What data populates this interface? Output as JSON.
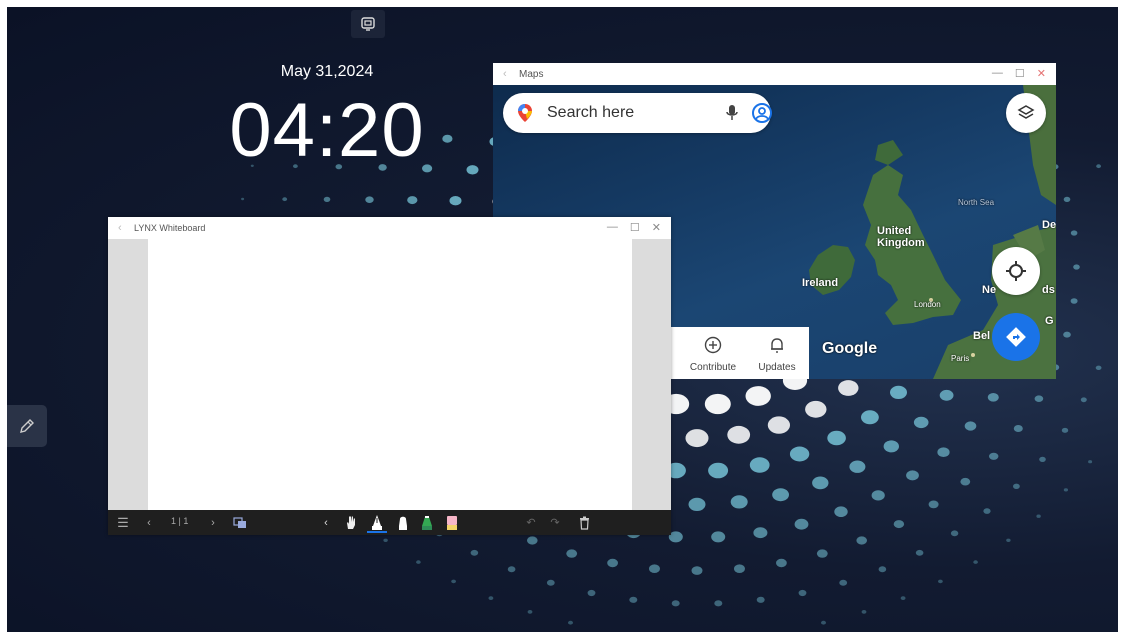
{
  "desktop": {
    "date": "May 31,2024",
    "time": "04:20",
    "top_icon": "screen-share-icon",
    "side_icon": "pencil-icon"
  },
  "maps_window": {
    "title": "Maps",
    "search": {
      "placeholder": "Search here"
    },
    "icons": [
      "maps-pin-icon",
      "microphone-icon",
      "account-icon",
      "layers-icon",
      "my-location-icon",
      "directions-icon"
    ],
    "labels": {
      "united_kingdom": "United\nKingdom",
      "ireland": "Ireland",
      "london": "London",
      "north_sea": "North Sea",
      "de": "De",
      "ne": "Ne",
      "ds": "ds",
      "g": "G",
      "bel": "Bel",
      "paris": "Paris"
    },
    "logo": "Google",
    "bottom_nav": [
      {
        "label": "Contribute",
        "icon": "plus-circle-icon"
      },
      {
        "label": "Updates",
        "icon": "bell-icon"
      }
    ]
  },
  "whiteboard_window": {
    "title": "LYNX Whiteboard",
    "page_indicator": "1 | 1",
    "toolbar_icons": [
      "menu-icon",
      "prev-page-icon",
      "next-page-icon",
      "layers-icon",
      "collapse-icon",
      "hand-icon",
      "pen-icon",
      "marker-icon",
      "highlighter-icon",
      "eraser-icon",
      "undo-icon",
      "redo-icon",
      "delete-icon"
    ]
  },
  "colors": {
    "background": "#0f1830",
    "dot": "#7fd3e6",
    "accent_blue": "#1a73e8",
    "whiteboard_toolbar": "#1f1f1f"
  }
}
